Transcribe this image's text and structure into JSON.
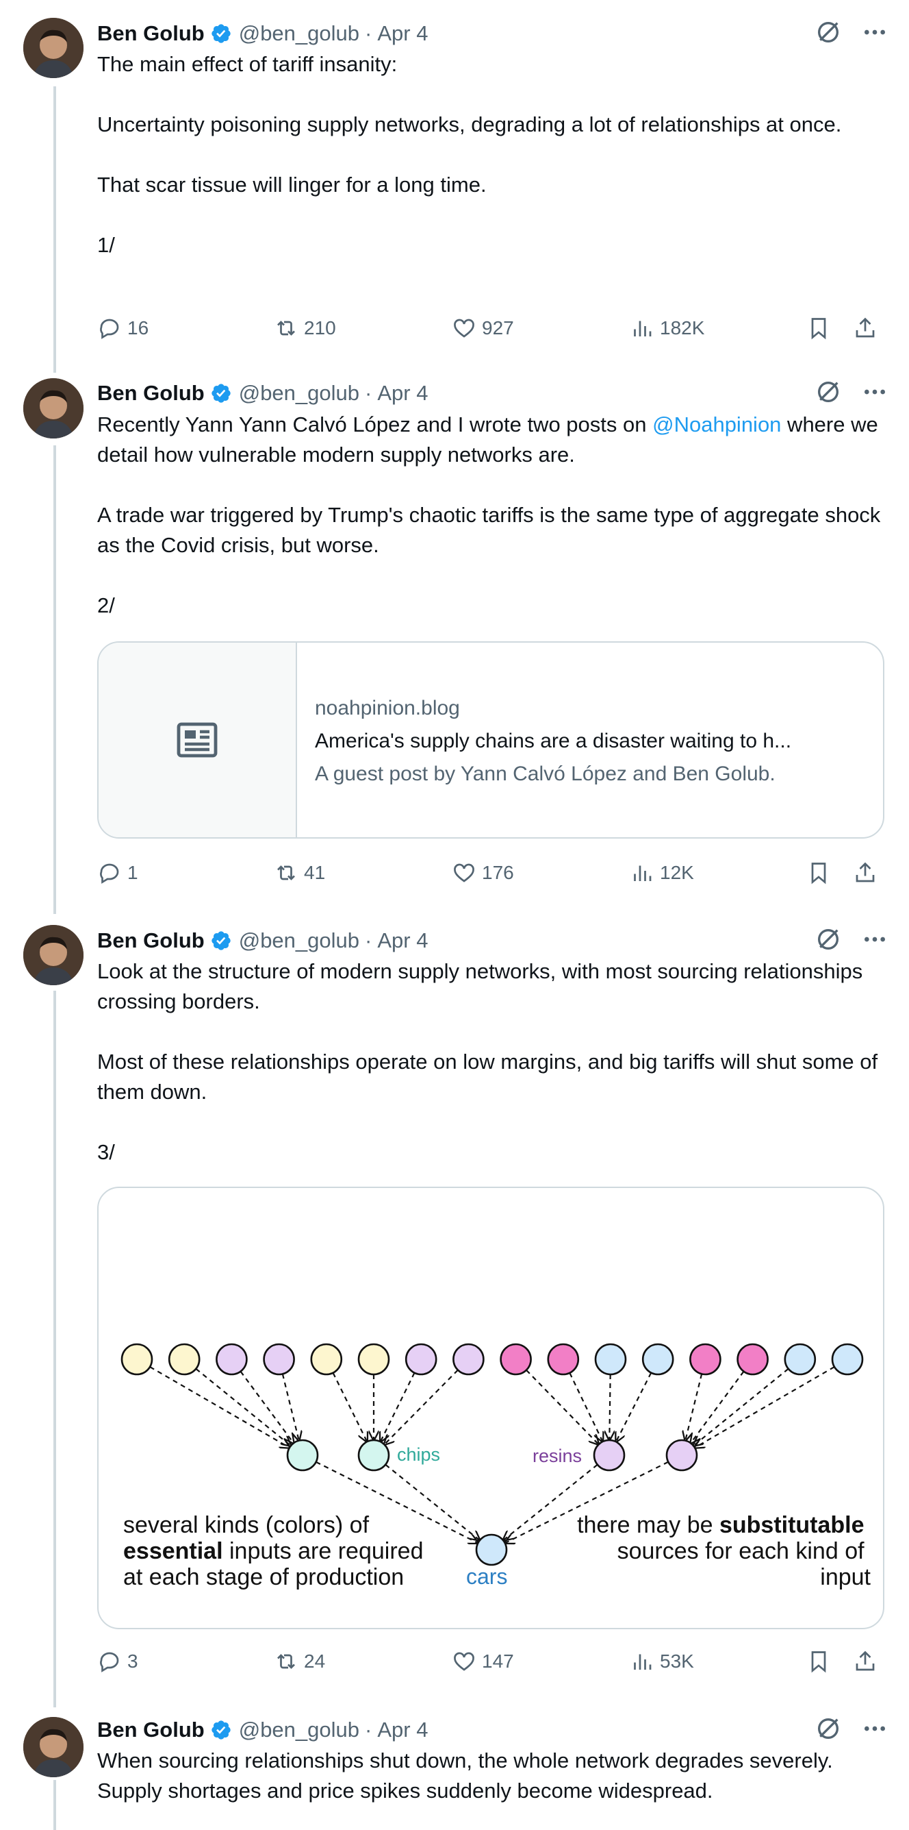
{
  "author": {
    "name": "Ben Golub",
    "handle": "@ben_golub"
  },
  "colors": {
    "accent": "#1d9bf0",
    "muted": "#536471",
    "thread_line": "#cfd9de"
  },
  "tweets": [
    {
      "date": "Apr 4",
      "paragraphs": [
        "The main effect of tariff insanity:",
        "Uncertainty poisoning supply networks, degrading a lot of relationships at once.",
        "That scar tissue will linger for a long time.",
        "1/"
      ],
      "replies": "16",
      "reposts": "210",
      "likes": "927",
      "views": "182K"
    },
    {
      "date": "Apr 4",
      "p1_before": "Recently Yann Yann Calvó López and I wrote two posts on ",
      "p1_mention": "@Noahpinion",
      "p1_after": " where we detail how vulnerable modern supply networks are.",
      "paragraphs": [
        "A trade war triggered by Trump's chaotic tariffs is the same type of aggregate shock as the Covid crisis, but worse.",
        "2/"
      ],
      "card": {
        "domain": "noahpinion.blog",
        "title": "America's supply chains are a disaster waiting to h...",
        "description": "A guest post by Yann Calvó López and Ben Golub."
      },
      "replies": "1",
      "reposts": "41",
      "likes": "176",
      "views": "12K"
    },
    {
      "date": "Apr 4",
      "paragraphs": [
        "Look at the structure of modern supply networks, with most sourcing relationships crossing borders.",
        "Most of these relationships operate on low margins, and big tariffs will shut some of them down.",
        "3/"
      ],
      "diagram": {
        "label_chips": "chips",
        "label_resins": "resins",
        "label_cars": "cars",
        "left_caption_1": "several kinds (colors) of",
        "left_caption_2_bold": "essential",
        "left_caption_2_rest": " inputs are required",
        "left_caption_3": "at each stage of production",
        "right_caption_1_pre": "there may be ",
        "right_caption_1_bold": "substitutable",
        "right_caption_2": "sources for each kind of",
        "right_caption_3": "input",
        "node_colors": {
          "yellow": "#fdf6cf",
          "purple": "#e6d0f5",
          "pink": "#f27fc6",
          "blue": "#cfe8fb",
          "teal": "#d4f6ef"
        }
      },
      "replies": "3",
      "reposts": "24",
      "likes": "147",
      "views": "53K"
    },
    {
      "date": "Apr 4",
      "paragraphs": [
        "When sourcing relationships shut down, the whole network degrades severely. Supply shortages and price spikes suddenly become widespread."
      ]
    }
  ]
}
